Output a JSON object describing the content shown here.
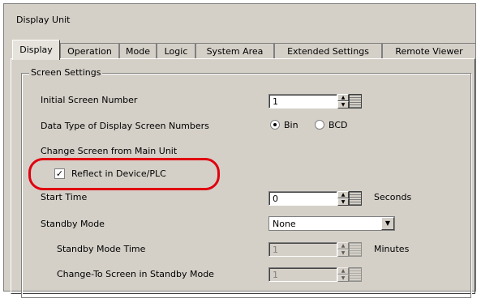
{
  "window": {
    "title": "Display Unit"
  },
  "tabs": [
    {
      "label": "Display",
      "active": true
    },
    {
      "label": "Operation",
      "active": false
    },
    {
      "label": "Mode",
      "active": false
    },
    {
      "label": "Logic",
      "active": false
    },
    {
      "label": "System Area",
      "active": false
    },
    {
      "label": "Extended Settings",
      "active": false
    },
    {
      "label": "Remote Viewer",
      "active": false
    }
  ],
  "screen_settings": {
    "group_label": "Screen Settings",
    "initial_screen_number": {
      "label": "Initial Screen Number",
      "value": "1"
    },
    "data_type": {
      "label": "Data Type of Display Screen Numbers",
      "options": [
        "Bin",
        "BCD"
      ],
      "selected": "Bin"
    },
    "change_screen": {
      "label": "Change Screen from Main Unit"
    },
    "reflect": {
      "label": "Reflect in Device/PLC",
      "checked": true
    },
    "start_time": {
      "label": "Start Time",
      "value": "0",
      "unit": "Seconds"
    },
    "standby_mode": {
      "label": "Standby Mode",
      "value": "None"
    },
    "standby_mode_time": {
      "label": "Standby Mode Time",
      "value": "1",
      "unit": "Minutes",
      "enabled": false
    },
    "change_to_screen": {
      "label": "Change-To Screen in Standby Mode",
      "value": "1",
      "enabled": false
    }
  },
  "colors": {
    "highlight": "#e0000f",
    "face": "#d4d0c8"
  },
  "icons": {
    "spin_up": "▲",
    "spin_down": "▼",
    "dropdown": "▼",
    "check": "✓"
  }
}
